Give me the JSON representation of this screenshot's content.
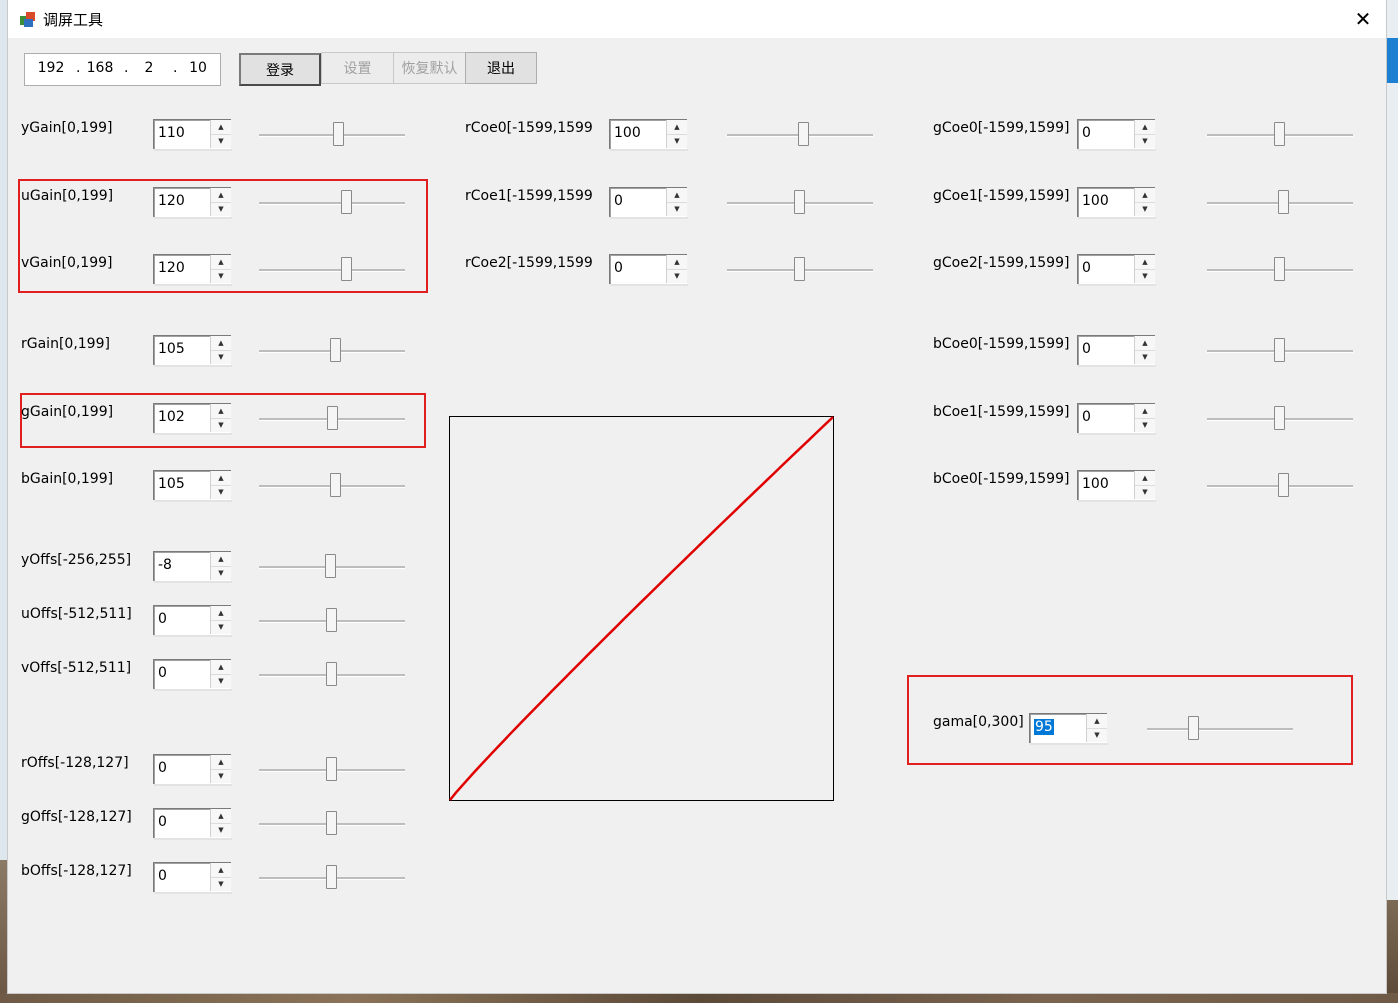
{
  "window": {
    "title": "调屏工具",
    "close_symbol": "✕"
  },
  "ip": {
    "oct1": "192",
    "oct2": "168",
    "oct3": "2",
    "oct4": "10",
    "dot": "."
  },
  "toolbar": {
    "login": "登录",
    "settings": "设置",
    "restore": "恢复默认",
    "exit": "退出"
  },
  "left": [
    {
      "key": "ygain",
      "label": "yGain[0,199]",
      "value": "110",
      "level": 0.55
    },
    {
      "key": "ugain",
      "label": "uGain[0,199]",
      "value": "120",
      "level": 0.6
    },
    {
      "key": "vgain",
      "label": "vGain[0,199]",
      "value": "120",
      "level": 0.6
    },
    {
      "key": "rgain",
      "label": "rGain[0,199]",
      "value": "105",
      "level": 0.53
    },
    {
      "key": "ggain",
      "label": "gGain[0,199]",
      "value": "102",
      "level": 0.51
    },
    {
      "key": "bgain",
      "label": "bGain[0,199]",
      "value": "105",
      "level": 0.53
    },
    {
      "key": "yoffs",
      "label": "yOffs[-256,255]",
      "value": "-8",
      "level": 0.49
    },
    {
      "key": "uoffs",
      "label": "uOffs[-512,511]",
      "value": "0",
      "level": 0.5
    },
    {
      "key": "voffs",
      "label": "vOffs[-512,511]",
      "value": "0",
      "level": 0.5
    },
    {
      "key": "roffs",
      "label": "rOffs[-128,127]",
      "value": "0",
      "level": 0.5
    },
    {
      "key": "goffs",
      "label": "gOffs[-128,127]",
      "value": "0",
      "level": 0.5
    },
    {
      "key": "boffs",
      "label": "bOffs[-128,127]",
      "value": "0",
      "level": 0.5
    }
  ],
  "middle": [
    {
      "key": "rcoe0",
      "label": "rCoe0[-1599,1599",
      "value": "100",
      "level": 0.53
    },
    {
      "key": "rcoe1",
      "label": "rCoe1[-1599,1599",
      "value": "0",
      "level": 0.5
    },
    {
      "key": "rcoe2",
      "label": "rCoe2[-1599,1599",
      "value": "0",
      "level": 0.5
    }
  ],
  "right": [
    {
      "key": "gcoe0",
      "label": "gCoe0[-1599,1599]",
      "value": "0",
      "level": 0.5
    },
    {
      "key": "gcoe1",
      "label": "gCoe1[-1599,1599]",
      "value": "100",
      "level": 0.53
    },
    {
      "key": "gcoe2",
      "label": "gCoe2[-1599,1599]",
      "value": "0",
      "level": 0.5
    },
    {
      "key": "bcoe0",
      "label": "bCoe0[-1599,1599]",
      "value": "0",
      "level": 0.5
    },
    {
      "key": "bcoe1",
      "label": "bCoe1[-1599,1599]",
      "value": "0",
      "level": 0.5
    },
    {
      "key": "bcoe2",
      "label": "bCoe0[-1599,1599]",
      "value": "100",
      "level": 0.53
    }
  ],
  "gama": {
    "label": "gama[0,300]",
    "value": "95",
    "level": 0.32
  },
  "spin_symbols": {
    "up": "▲",
    "down": "▼"
  },
  "colors": {
    "highlight": "#e02020",
    "curve": "#e00000",
    "selection": "#0078d7"
  }
}
